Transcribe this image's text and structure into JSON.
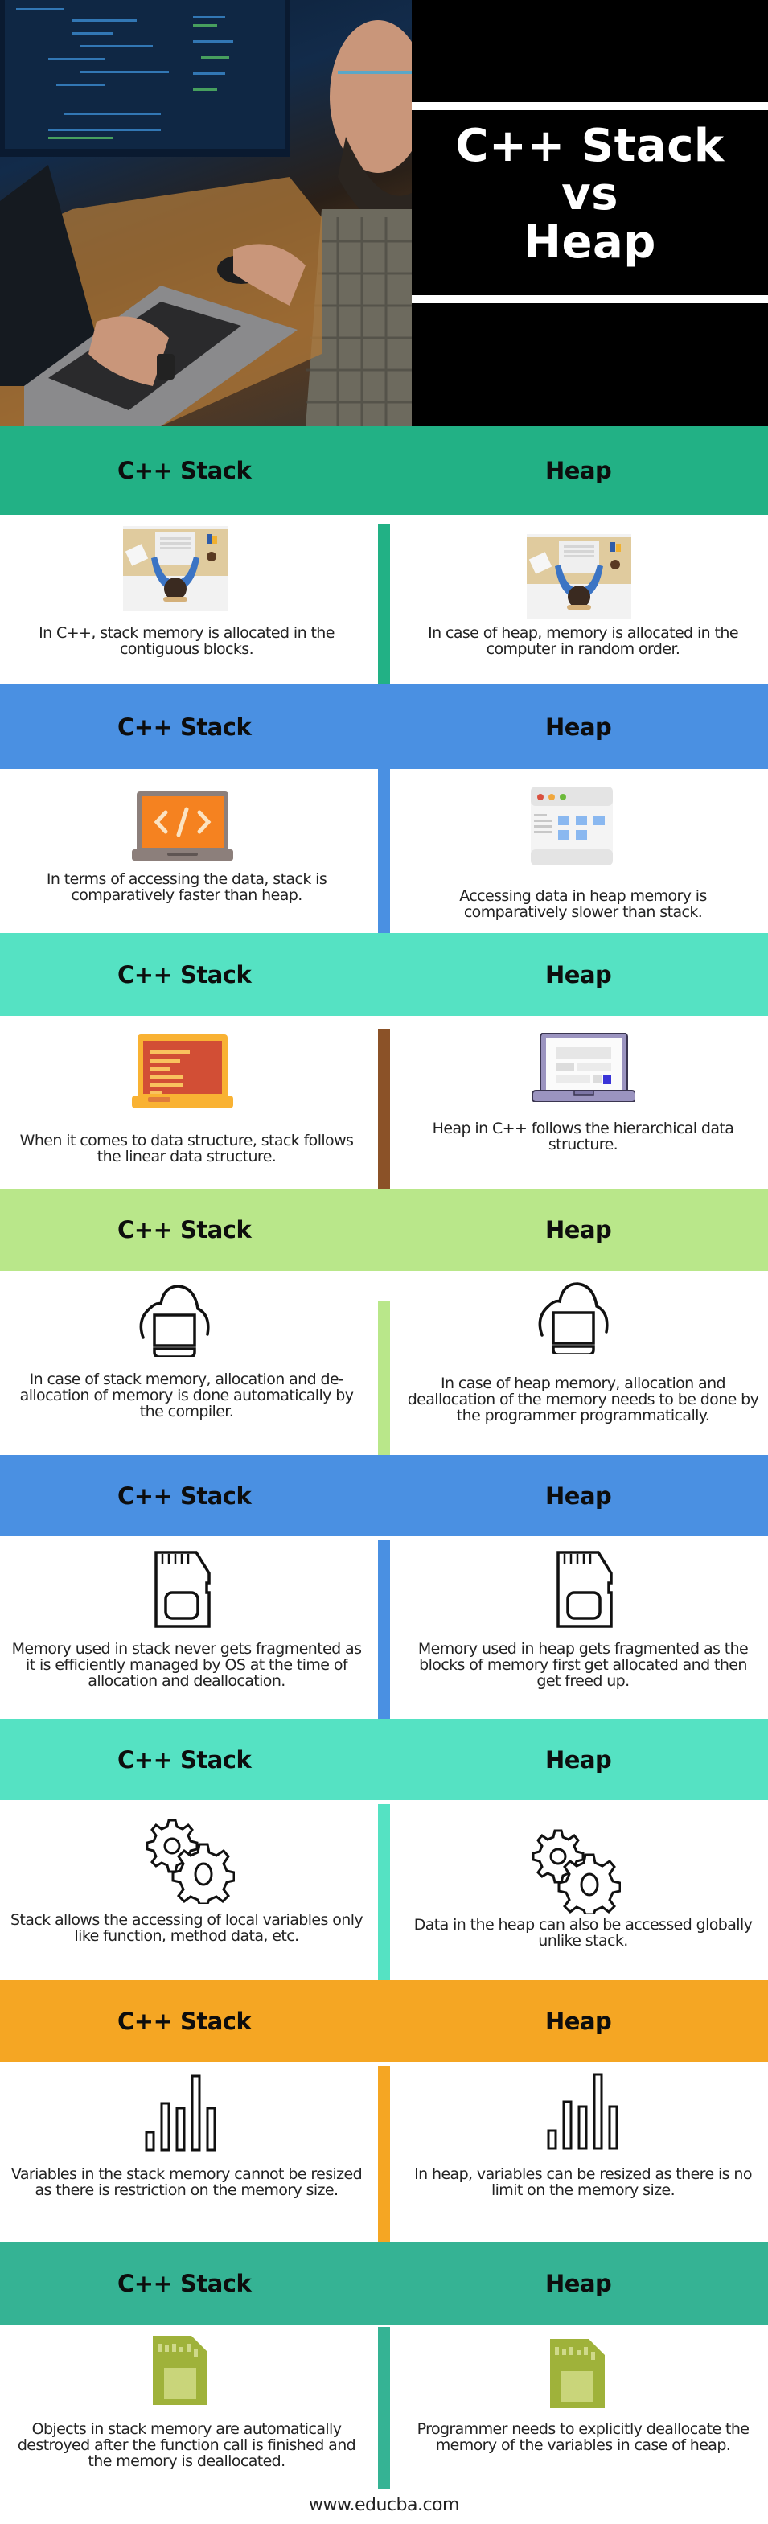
{
  "hero": {
    "title_lines": [
      "C++ Stack",
      "vs",
      "Heap"
    ],
    "photo": "developer-at-desk-photo"
  },
  "column_headers": {
    "left": "C++ Stack",
    "right": "Heap"
  },
  "sections": [
    {
      "header_color": "#22b185",
      "divider_color": "#22b185",
      "left": {
        "icon": "desk-workspace-illustration-icon",
        "text": "In C++, stack memory is allocated in the contiguous blocks."
      },
      "right": {
        "icon": "desk-workspace-illustration-icon",
        "text": "In case of heap, memory is allocated in the computer in random order."
      }
    },
    {
      "header_color": "#4a90e2",
      "divider_color": "#4a90e2",
      "left": {
        "icon": "laptop-code-icon",
        "text": "In terms of accessing the data, stack is comparatively faster than heap."
      },
      "right": {
        "icon": "browser-window-icon",
        "text": "Accessing data in heap memory is comparatively slower than stack."
      }
    },
    {
      "header_color": "#55e2c3",
      "divider_color": "#8b5228",
      "left": {
        "icon": "tablet-text-icon",
        "text": "When it comes to data structure, stack follows the linear data structure."
      },
      "right": {
        "icon": "laptop-dashboard-icon",
        "text": "Heap in C++ follows the hierarchical data structure."
      }
    },
    {
      "header_color": "#b9e78a",
      "divider_color": "#b9e78a",
      "left": {
        "icon": "cloud-computer-icon",
        "text": "In case of stack memory, allocation and de- allocation of memory is done automatically by the compiler."
      },
      "right": {
        "icon": "cloud-computer-icon",
        "text": "In case of heap memory, allocation and deallocation of the memory needs to be done by the programmer programmatically."
      }
    },
    {
      "header_color": "#4a90e2",
      "divider_color": "#4a90e2",
      "left": {
        "icon": "sd-card-outline-icon",
        "text": "Memory used in stack never gets fragmented as it is efficiently managed by OS at the time of allocation and deallocation."
      },
      "right": {
        "icon": "sd-card-outline-icon",
        "text": "Memory used in heap gets fragmented as the blocks of memory first get allocated and then get freed up."
      }
    },
    {
      "header_color": "#55e2c3",
      "divider_color": "#55e2c3",
      "left": {
        "icon": "gears-icon",
        "text": "Stack allows the accessing of local variables only like function, method data, etc."
      },
      "right": {
        "icon": "gears-icon",
        "text": "Data in the heap can also be accessed globally unlike stack."
      }
    },
    {
      "header_color": "#f5a623",
      "divider_color": "#f5a623",
      "left": {
        "icon": "bar-chart-outline-icon",
        "text": "Variables in the stack memory cannot be resized as there is restriction on the memory size."
      },
      "right": {
        "icon": "bar-chart-outline-icon",
        "text": "In heap, variables can be resized as there is no limit on the memory size."
      }
    },
    {
      "header_color": "#35b394",
      "divider_color": "#35b394",
      "left": {
        "icon": "sd-card-green-icon",
        "text": "Objects in stack memory are automatically destroyed after the function call is finished and the memory is deallocated."
      },
      "right": {
        "icon": "sd-card-green-icon",
        "text": "Programmer needs to explicitly deallocate the memory of the variables in case of heap."
      }
    }
  ],
  "footer": {
    "site": "www.educba.com"
  }
}
